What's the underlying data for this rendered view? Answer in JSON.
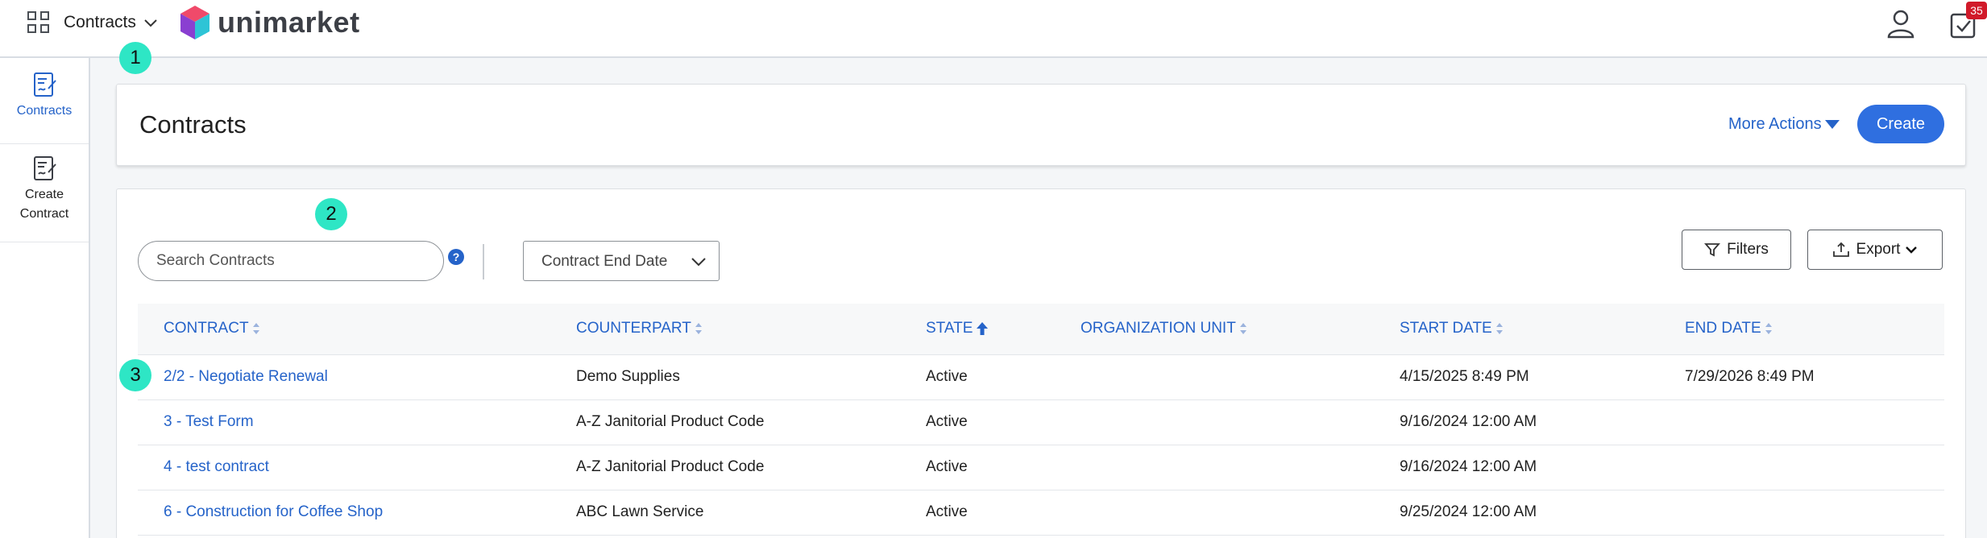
{
  "topbar": {
    "app_label": "Contracts",
    "brand": "unimarket",
    "tasks_count": "35"
  },
  "sidebar": {
    "items": [
      {
        "label": "Contracts"
      },
      {
        "label_line1": "Create",
        "label_line2": "Contract"
      }
    ]
  },
  "header": {
    "title": "Contracts",
    "more_actions": "More Actions",
    "create": "Create"
  },
  "toolbar": {
    "search_placeholder": "Search Contracts",
    "help": "?",
    "date_filter": "Contract End Date",
    "filters": "Filters",
    "export": "Export"
  },
  "table": {
    "columns": [
      "CONTRACT",
      "COUNTERPART",
      "STATE",
      "ORGANIZATION UNIT",
      "START DATE",
      "END DATE"
    ],
    "sorted_column": "STATE",
    "rows": [
      {
        "contract": "2/2 - Negotiate Renewal",
        "counterpart": "Demo Supplies",
        "state": "Active",
        "org_unit": "",
        "start": "4/15/2025 8:49 PM",
        "end": "7/29/2026 8:49 PM"
      },
      {
        "contract": "3 - Test Form",
        "counterpart": "A-Z Janitorial Product Code",
        "state": "Active",
        "org_unit": "",
        "start": "9/16/2024 12:00 AM",
        "end": ""
      },
      {
        "contract": "4 - test contract",
        "counterpart": "A-Z Janitorial Product Code",
        "state": "Active",
        "org_unit": "",
        "start": "9/16/2024 12:00 AM",
        "end": ""
      },
      {
        "contract": "6 - Construction for Coffee Shop",
        "counterpart": "ABC Lawn Service",
        "state": "Active",
        "org_unit": "",
        "start": "9/25/2024 12:00 AM",
        "end": ""
      }
    ]
  },
  "markers": [
    "1",
    "2",
    "3"
  ],
  "colors": {
    "accent": "#2563c9",
    "primary_button": "#2f6fe0",
    "badge": "#d11a2a",
    "marker": "#2ee6c5"
  }
}
